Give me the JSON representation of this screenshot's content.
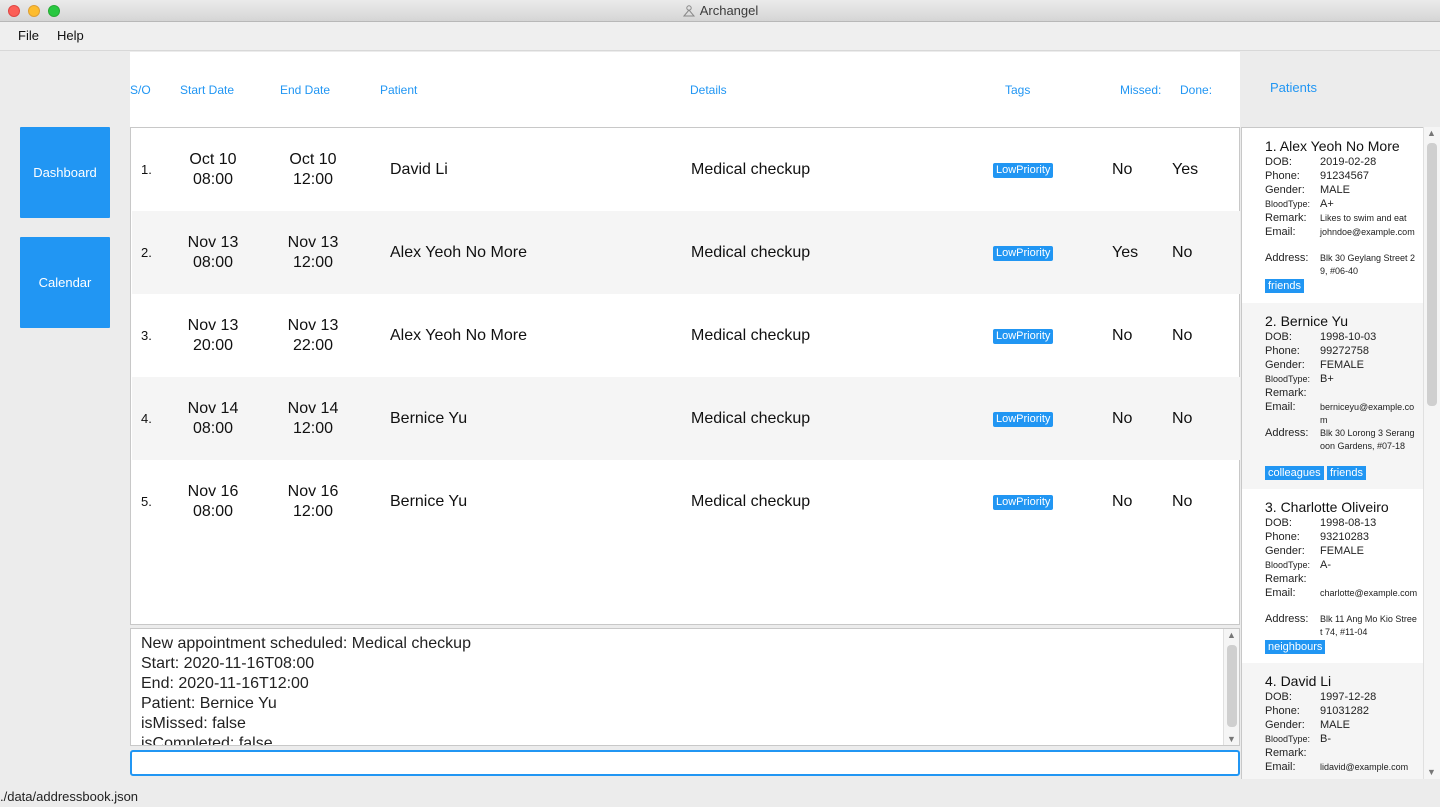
{
  "window": {
    "title": "Archangel"
  },
  "menu": {
    "file": "File",
    "help": "Help"
  },
  "sidebar": {
    "dashboard": "Dashboard",
    "calendar": "Calendar"
  },
  "table": {
    "headers": {
      "so": "S/O",
      "start": "Start Date",
      "end": "End Date",
      "patient": "Patient",
      "details": "Details",
      "tags": "Tags",
      "missed": "Missed:",
      "done": "Done:"
    },
    "rows": [
      {
        "index": "1.",
        "start_day": "Oct 10",
        "start_time": "08:00",
        "end_day": "Oct 10",
        "end_time": "12:00",
        "patient": "David Li",
        "details": "Medical checkup",
        "tag": "LowPriority",
        "missed": "No",
        "done": "Yes"
      },
      {
        "index": "2.",
        "start_day": "Nov 13",
        "start_time": "08:00",
        "end_day": "Nov 13",
        "end_time": "12:00",
        "patient": "Alex Yeoh No More",
        "details": "Medical checkup",
        "tag": "LowPriority",
        "missed": "Yes",
        "done": "No"
      },
      {
        "index": "3.",
        "start_day": "Nov 13",
        "start_time": "20:00",
        "end_day": "Nov 13",
        "end_time": "22:00",
        "patient": "Alex Yeoh No More",
        "details": "Medical checkup",
        "tag": "LowPriority",
        "missed": "No",
        "done": "No"
      },
      {
        "index": "4.",
        "start_day": "Nov 14",
        "start_time": "08:00",
        "end_day": "Nov 14",
        "end_time": "12:00",
        "patient": "Bernice Yu",
        "details": "Medical checkup",
        "tag": "LowPriority",
        "missed": "No",
        "done": "No"
      },
      {
        "index": "5.",
        "start_day": "Nov 16",
        "start_time": "08:00",
        "end_day": "Nov 16",
        "end_time": "12:00",
        "patient": "Bernice Yu",
        "details": "Medical checkup",
        "tag": "LowPriority",
        "missed": "No",
        "done": "No"
      }
    ]
  },
  "result": {
    "lines": [
      "New appointment scheduled: Medical checkup",
      "Start: 2020-11-16T08:00",
      "End: 2020-11-16T12:00",
      "Patient: Bernice Yu",
      "isMissed: false",
      "isCompleted: false"
    ]
  },
  "command": {
    "value": ""
  },
  "patients": {
    "title": "Patients",
    "labels": {
      "dob": "DOB:",
      "phone": "Phone:",
      "gender": "Gender:",
      "blood": "BloodType:",
      "remark": "Remark:",
      "email": "Email:",
      "address": "Address:"
    },
    "list": [
      {
        "name": "1. Alex Yeoh No More",
        "dob": "2019-02-28",
        "phone": "91234567",
        "gender": "MALE",
        "blood": "A+",
        "remark": "Likes to swim and eat",
        "email": "johndoe@example.com",
        "address": "Blk 30 Geylang Street 29, #06-40",
        "tags": [
          "friends"
        ]
      },
      {
        "name": "2. Bernice Yu",
        "dob": "1998-10-03",
        "phone": "99272758",
        "gender": "FEMALE",
        "blood": "B+",
        "remark": "",
        "email": "berniceyu@example.com",
        "address": "Blk 30 Lorong 3 Serangoon Gardens, #07-18",
        "tags": [
          "colleagues",
          "friends"
        ]
      },
      {
        "name": "3. Charlotte Oliveiro",
        "dob": "1998-08-13",
        "phone": "93210283",
        "gender": "FEMALE",
        "blood": "A-",
        "remark": "",
        "email": "charlotte@example.com",
        "address": "Blk 11 Ang Mo Kio Street 74, #11-04",
        "tags": [
          "neighbours"
        ]
      },
      {
        "name": "4. David Li",
        "dob": "1997-12-28",
        "phone": "91031282",
        "gender": "MALE",
        "blood": "B-",
        "remark": "",
        "email": "lidavid@example.com",
        "address": "",
        "tags": []
      }
    ]
  },
  "status": {
    "path": "./data/addressbook.json"
  }
}
